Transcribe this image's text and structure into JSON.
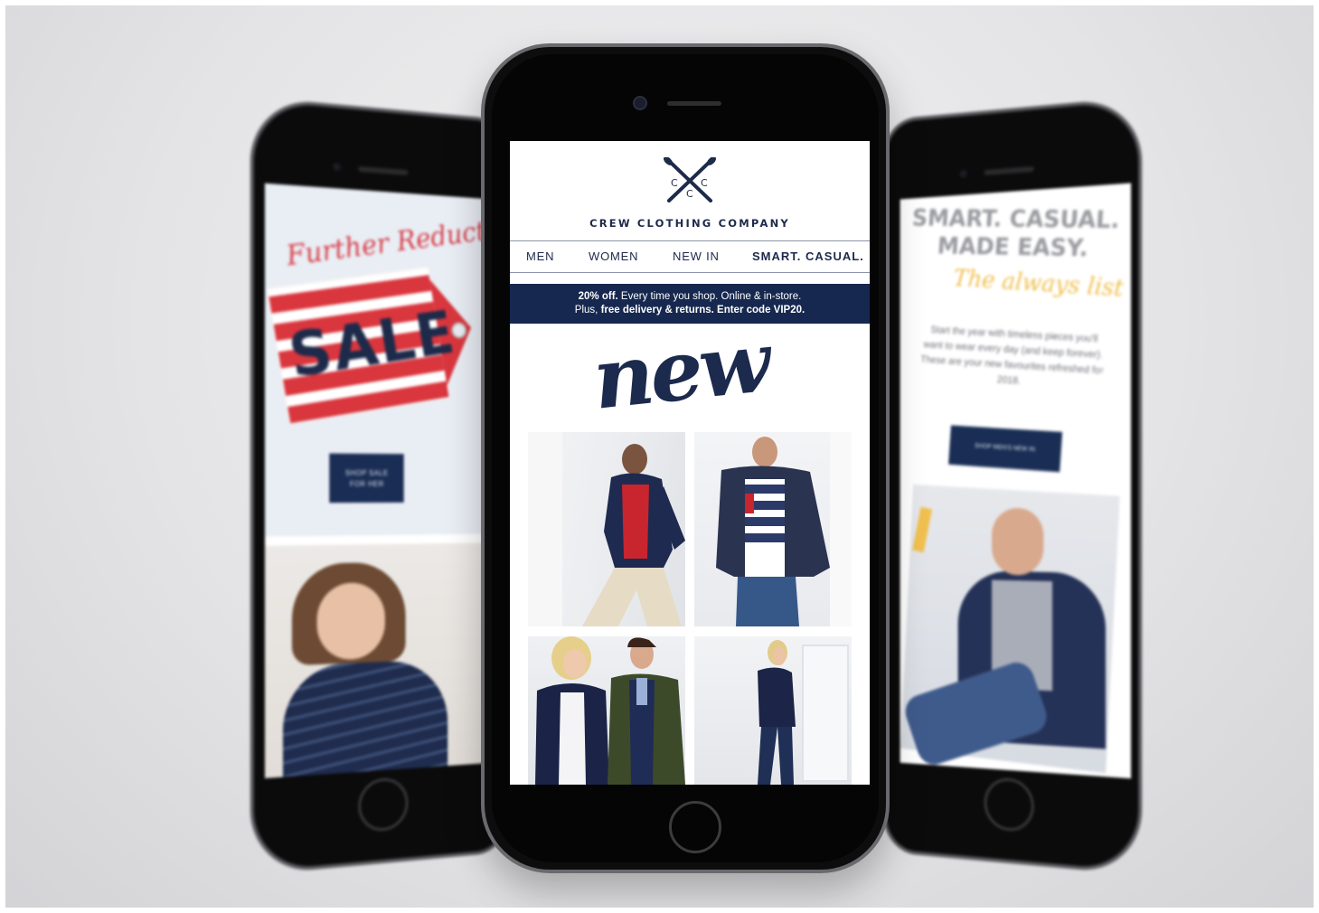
{
  "left_phone": {
    "script_heading": "Further Reductions",
    "tag_text": "SALE",
    "button_line1": "SHOP SALE",
    "button_line2": "FOR HER"
  },
  "right_phone": {
    "heading_line1": "SMART. CASUAL.",
    "heading_line2": "MADE EASY.",
    "script_text": "The always list",
    "body": "Start the year with timeless pieces you'll want to wear every day (and keep forever). These are your new favourites refreshed for 2018.",
    "button": "SHOP MEN'S NEW IN"
  },
  "email": {
    "logo_letters": [
      "C",
      "C",
      "C"
    ],
    "brand_name": "CREW CLOTHING COMPANY",
    "nav": [
      "MEN",
      "WOMEN",
      "NEW IN",
      "SMART. CASUAL."
    ],
    "promo": {
      "bold1": "20% off.",
      "text1": " Every time you shop. Online & in-store.",
      "text2": "Plus, ",
      "bold2": "free delivery & returns. Enter code VIP20."
    },
    "headline": "new"
  },
  "colors": {
    "navy": "#16284f",
    "brand_red": "#d9363d",
    "accent_yellow": "#f0c04f",
    "background": "#e4e4e6"
  }
}
